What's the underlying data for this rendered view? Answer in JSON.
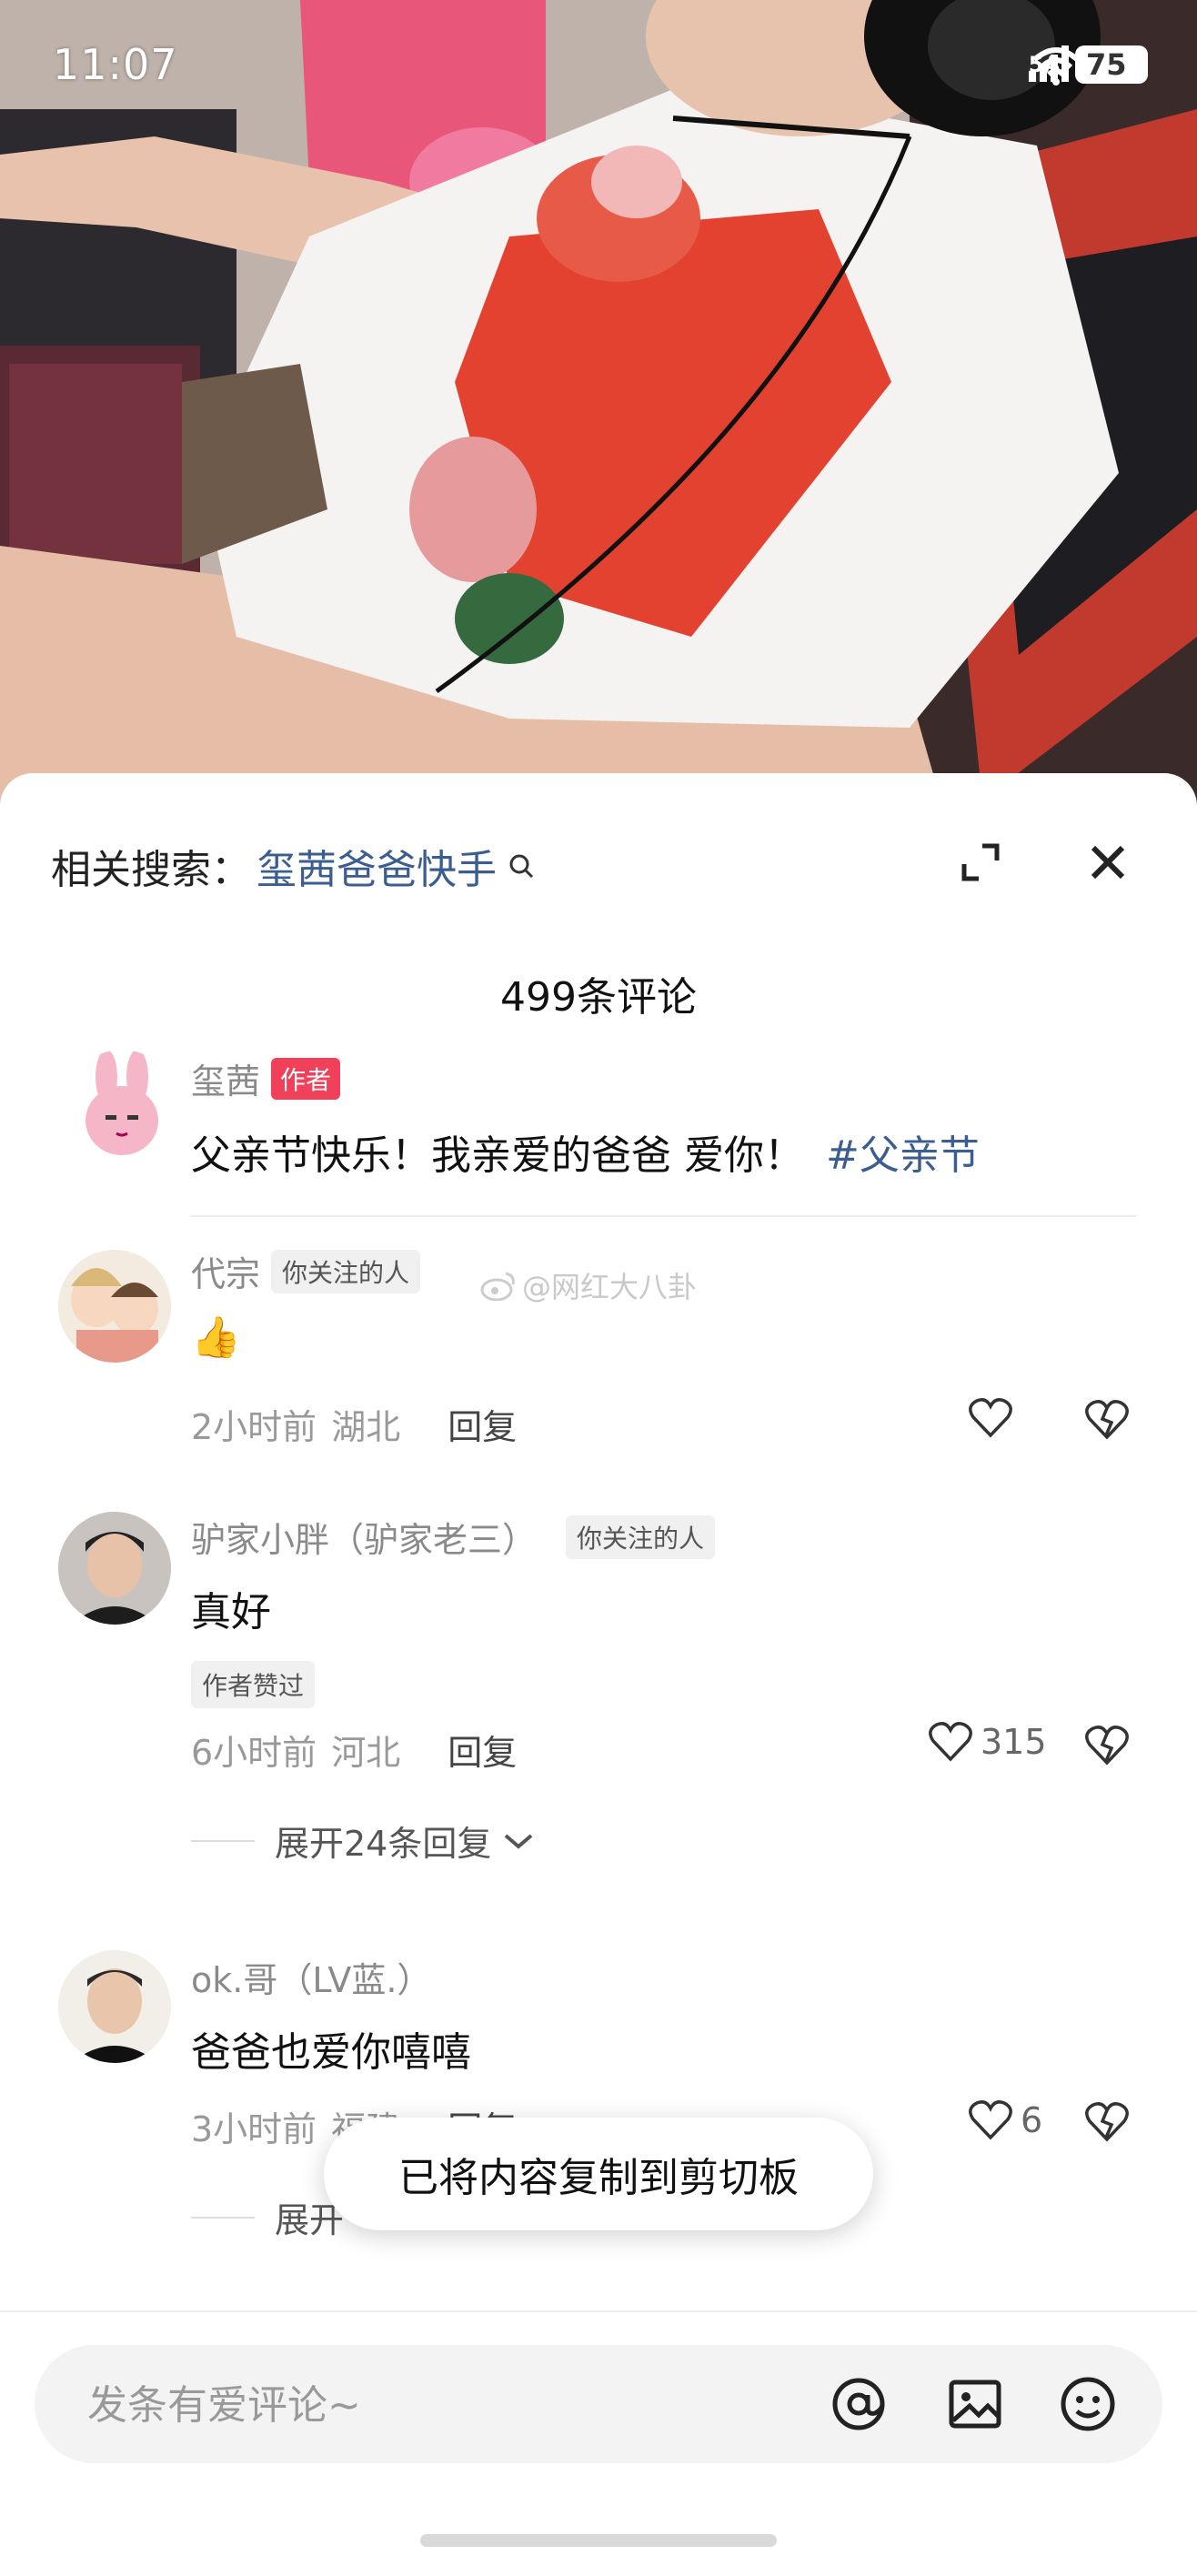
{
  "status_bar": {
    "time": "11:07",
    "network": "5A",
    "wifi_label": "6",
    "battery": "75"
  },
  "sheet": {
    "related_label": "相关搜索：",
    "related_keyword": "玺茜爸爸快手",
    "comment_count": "499条评论"
  },
  "author_comment": {
    "name": "玺茜",
    "tag": "作者",
    "text": "父亲节快乐！我亲爱的爸爸 爱你！",
    "hashtag": "#父亲节"
  },
  "watermark": "@网红大八卦",
  "comments": [
    {
      "name": "代宗",
      "tag": "你关注的人",
      "text": "👍",
      "time": "2小时前",
      "region": "湖北",
      "reply": "回复",
      "likes": ""
    },
    {
      "name": "驴家小胖（驴家老三）",
      "tag": "你关注的人",
      "text": "真好",
      "badge": "作者赞过",
      "time": "6小时前",
      "region": "河北",
      "reply": "回复",
      "likes": "315",
      "expand": "展开24条回复"
    },
    {
      "name": "ok.哥（LV蓝.）",
      "text": "爸爸也爱你嘻嘻",
      "time": "3小时前",
      "region": "福建",
      "reply": "回复",
      "likes": "6",
      "expand": "展开"
    }
  ],
  "toast": "已将内容复制到剪切板",
  "input": {
    "placeholder": "发条有爱评论~"
  },
  "icons": [
    "search-icon",
    "expand-icon",
    "close-icon",
    "heart-icon",
    "broken-heart-icon",
    "chevron-down-icon",
    "at-icon",
    "image-icon",
    "emoji-icon",
    "weibo-icon"
  ],
  "colors": {
    "accent_link": "#3b5d8f",
    "author_tag": "#f0405a"
  }
}
